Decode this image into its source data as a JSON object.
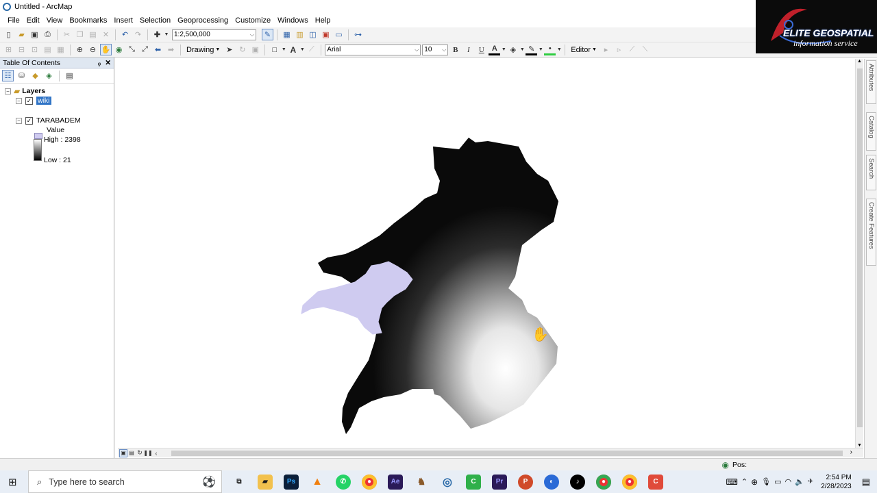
{
  "window": {
    "title": "Untitled - ArcMap"
  },
  "menu": [
    "File",
    "Edit",
    "View",
    "Bookmarks",
    "Insert",
    "Selection",
    "Geoprocessing",
    "Customize",
    "Windows",
    "Help"
  ],
  "toolbar": {
    "scale": "1:2,500,000",
    "drawing_label": "Drawing",
    "font_name": "Arial",
    "font_size": "10",
    "bold": "B",
    "italic": "I",
    "underline": "U",
    "text_tool": "A",
    "editor_label": "Editor"
  },
  "toc": {
    "title": "Table Of Contents",
    "root": "Layers",
    "layers": [
      {
        "name": "wiki",
        "checked": true,
        "symbol_color": "#cfcbf0",
        "selected": true
      },
      {
        "name": "TARABADEM",
        "checked": true,
        "legend_heading": "Value",
        "high": "High : 2398",
        "low": "Low : 21"
      }
    ]
  },
  "map": {
    "polygon_color": "#cfcbf0"
  },
  "right_dock": [
    "Attributes",
    "Catalog",
    "Search",
    "Create Features"
  ],
  "status": {
    "pos_label": "Pos:"
  },
  "logo": {
    "line1": "ELITE GEOSPATIAL",
    "line2": "information service"
  },
  "taskbar": {
    "search_placeholder": "Type here to search",
    "apps": [
      {
        "label": "Ps",
        "color": "#0b1f3a"
      },
      {
        "label": "Ae",
        "color": "#2a1a58"
      },
      {
        "label": "Pr",
        "color": "#2a1a58"
      }
    ],
    "time": "2:54 PM",
    "date": "2/28/2023"
  }
}
